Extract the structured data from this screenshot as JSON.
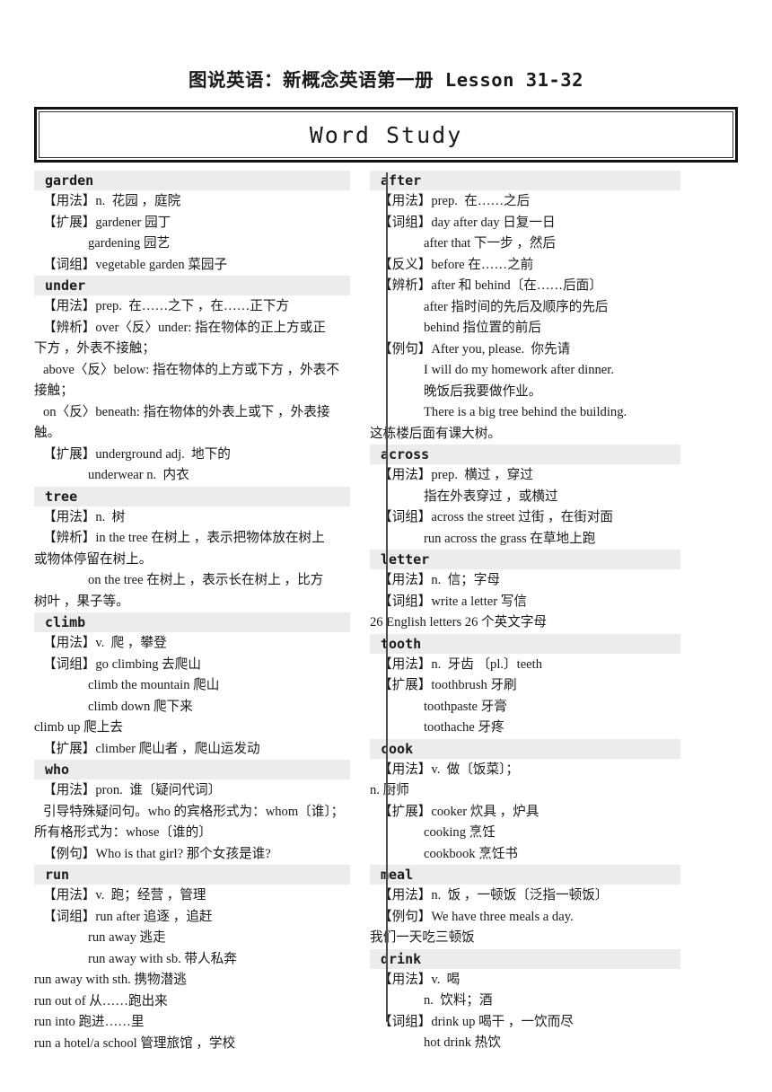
{
  "title": "图说英语：新概念英语第一册  Lesson 31-32",
  "banner": "Word Study",
  "colors": {
    "entry_header_bg": "#ececec",
    "divider": "#4d4d4d",
    "border": "#111111"
  },
  "left_column": [
    {
      "word": "garden",
      "lines": [
        {
          "indent": 1,
          "text": "【用法】n.  花园 ，庭院"
        },
        {
          "indent": 1,
          "text": "【扩展】gardener 园丁"
        },
        {
          "indent": 2,
          "text": "gardening 园艺"
        },
        {
          "indent": 1,
          "text": "【词组】vegetable garden 菜园子"
        }
      ]
    },
    {
      "word": "under",
      "lines": [
        {
          "indent": 1,
          "text": "【用法】prep.  在……之下 ，在……正下方"
        },
        {
          "indent": 1,
          "text": "【辨析】over〈反〉under: 指在物体的正上方或正"
        },
        {
          "indent": 0,
          "text": "下方 ，外表不接触；"
        },
        {
          "indent": 1,
          "text": "above〈反〉below: 指在物体的上方或下方 ，外表不"
        },
        {
          "indent": 0,
          "text": "接触；"
        },
        {
          "indent": 1,
          "text": "on〈反〉beneath: 指在物体的外表上或下 ，外表接"
        },
        {
          "indent": 0,
          "text": "触。"
        },
        {
          "indent": 1,
          "text": "【扩展】underground adj.  地下的"
        },
        {
          "indent": 2,
          "text": "underwear n.  内衣"
        }
      ]
    },
    {
      "word": "tree",
      "lines": [
        {
          "indent": 1,
          "text": "【用法】n.  树"
        },
        {
          "indent": 1,
          "text": "【辨析】in the tree 在树上 ，表示把物体放在树上"
        },
        {
          "indent": 0,
          "text": "或物体停留在树上。"
        },
        {
          "indent": 2,
          "text": "on the tree 在树上 ，表示长在树上 ，比方"
        },
        {
          "indent": 0,
          "text": "树叶 ，果子等。"
        }
      ]
    },
    {
      "word": "climb",
      "lines": [
        {
          "indent": 1,
          "text": "【用法】v.  爬 ，攀登"
        },
        {
          "indent": 1,
          "text": "【词组】go climbing 去爬山"
        },
        {
          "indent": 2,
          "text": "climb the mountain 爬山"
        },
        {
          "indent": 2,
          "text": "climb down 爬下来"
        },
        {
          "indent": 0,
          "text": "climb up 爬上去"
        },
        {
          "indent": 1,
          "text": "【扩展】climber 爬山者 ，爬山运发动"
        }
      ]
    },
    {
      "word": "who",
      "lines": [
        {
          "indent": 1,
          "text": "【用法】pron.  谁〔疑问代词〕"
        },
        {
          "indent": 1,
          "text": "引导特殊疑问句。who 的宾格形式为：whom〔谁〕；"
        },
        {
          "indent": 0,
          "text": "所有格形式为：whose〔谁的〕"
        },
        {
          "indent": 1,
          "text": "【例句】Who is that girl? 那个女孩是谁?"
        }
      ]
    },
    {
      "word": "run",
      "lines": [
        {
          "indent": 1,
          "text": "【用法】v.  跑；经营 ，管理"
        },
        {
          "indent": 1,
          "text": "【词组】run after 追逐 ，追赶"
        },
        {
          "indent": 2,
          "text": "run away 逃走"
        },
        {
          "indent": 2,
          "text": "run away with sb. 带人私奔"
        },
        {
          "indent": 0,
          "text": "run away with sth. 携物潜逃"
        },
        {
          "indent": 0,
          "text": "run out of 从……跑出来"
        },
        {
          "indent": 0,
          "text": "run into 跑进……里"
        },
        {
          "indent": 0,
          "text": "run a hotel/a school 管理旅馆 ，学校"
        }
      ]
    }
  ],
  "right_column": [
    {
      "word": "after",
      "lines": [
        {
          "indent": 1,
          "text": "【用法】prep.  在……之后"
        },
        {
          "indent": 1,
          "text": "【词组】day after day 日复一日"
        },
        {
          "indent": 2,
          "text": "after that 下一步 ，然后"
        },
        {
          "indent": 1,
          "text": "【反义】before 在……之前"
        },
        {
          "indent": 1,
          "text": "【辨析】after 和 behind〔在……后面〕"
        },
        {
          "indent": 2,
          "text": "after 指时间的先后及顺序的先后"
        },
        {
          "indent": 2,
          "text": "behind 指位置的前后"
        },
        {
          "indent": 1,
          "text": "【例句】After you, please.  你先请"
        },
        {
          "indent": 2,
          "text": "I will do my homework after dinner."
        },
        {
          "indent": 2,
          "text": "晚饭后我要做作业。"
        },
        {
          "indent": 2,
          "text": "There is a big tree behind the building."
        },
        {
          "indent": 0,
          "text": "这栋楼后面有课大树。"
        }
      ]
    },
    {
      "word": "across",
      "lines": [
        {
          "indent": 1,
          "text": "【用法】prep.  横过 ，穿过"
        },
        {
          "indent": 2,
          "text": "指在外表穿过 ，或横过"
        },
        {
          "indent": 1,
          "text": "【词组】across the street 过街 ，在街对面"
        },
        {
          "indent": 2,
          "text": "run across the grass 在草地上跑"
        }
      ]
    },
    {
      "word": "letter",
      "lines": [
        {
          "indent": 1,
          "text": "【用法】n.  信；字母"
        },
        {
          "indent": 1,
          "text": "【词组】write a letter 写信"
        },
        {
          "indent": 0,
          "text": "26 English letters 26 个英文字母"
        }
      ]
    },
    {
      "word": "tooth",
      "lines": [
        {
          "indent": 1,
          "text": "【用法】n.  牙齿 〔pl.〕teeth"
        },
        {
          "indent": 1,
          "text": "【扩展】toothbrush 牙刷"
        },
        {
          "indent": 2,
          "text": "toothpaste 牙膏"
        },
        {
          "indent": 2,
          "text": "toothache 牙疼"
        }
      ]
    },
    {
      "word": "cook",
      "lines": [
        {
          "indent": 1,
          "text": "【用法】v.  做〔饭菜〕；"
        },
        {
          "indent": 0,
          "text": "n. 厨师"
        },
        {
          "indent": 1,
          "text": "【扩展】cooker 炊具 ，炉具"
        },
        {
          "indent": 2,
          "text": "cooking 烹饪"
        },
        {
          "indent": 2,
          "text": "cookbook 烹饪书"
        }
      ]
    },
    {
      "word": "meal",
      "lines": [
        {
          "indent": 1,
          "text": "【用法】n.  饭 ，一顿饭〔泛指一顿饭〕"
        },
        {
          "indent": 1,
          "text": "【例句】We have three meals a day."
        },
        {
          "indent": 0,
          "text": "我们一天吃三顿饭"
        }
      ]
    },
    {
      "word": "drink",
      "lines": [
        {
          "indent": 1,
          "text": "【用法】v.  喝"
        },
        {
          "indent": 2,
          "text": "n.  饮料；酒"
        },
        {
          "indent": 1,
          "text": "【词组】drink up 喝干 ，一饮而尽"
        },
        {
          "indent": 2,
          "text": "hot drink 热饮"
        }
      ]
    }
  ]
}
